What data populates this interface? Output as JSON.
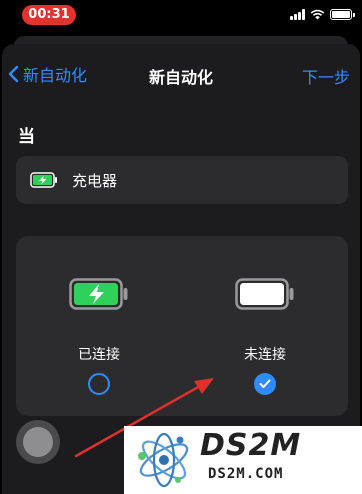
{
  "status_bar": {
    "time": "00:31",
    "icons": [
      "cellular-signal-icon",
      "wifi-icon",
      "battery-icon"
    ],
    "time_pill_color": "#e5322c"
  },
  "nav": {
    "back_label": "新自动化",
    "title": "新自动化",
    "next_label": "下一步",
    "accent_color": "#2f8cff"
  },
  "section": {
    "when_label": "当"
  },
  "trigger": {
    "icon": "charging-battery-icon",
    "label": "充电器"
  },
  "options": [
    {
      "icon": "charging-battery-icon",
      "label": "已连接",
      "selected": false
    },
    {
      "icon": "battery-full-white-icon",
      "label": "未连接",
      "selected": true
    }
  ],
  "watermark": {
    "title": "DS2M",
    "subtitle": "DS2M.COM"
  },
  "colors": {
    "background": "#1c1c1e",
    "card": "#2c2c2e",
    "battery_green": "#30d158",
    "annotation_red": "#e0302a"
  }
}
